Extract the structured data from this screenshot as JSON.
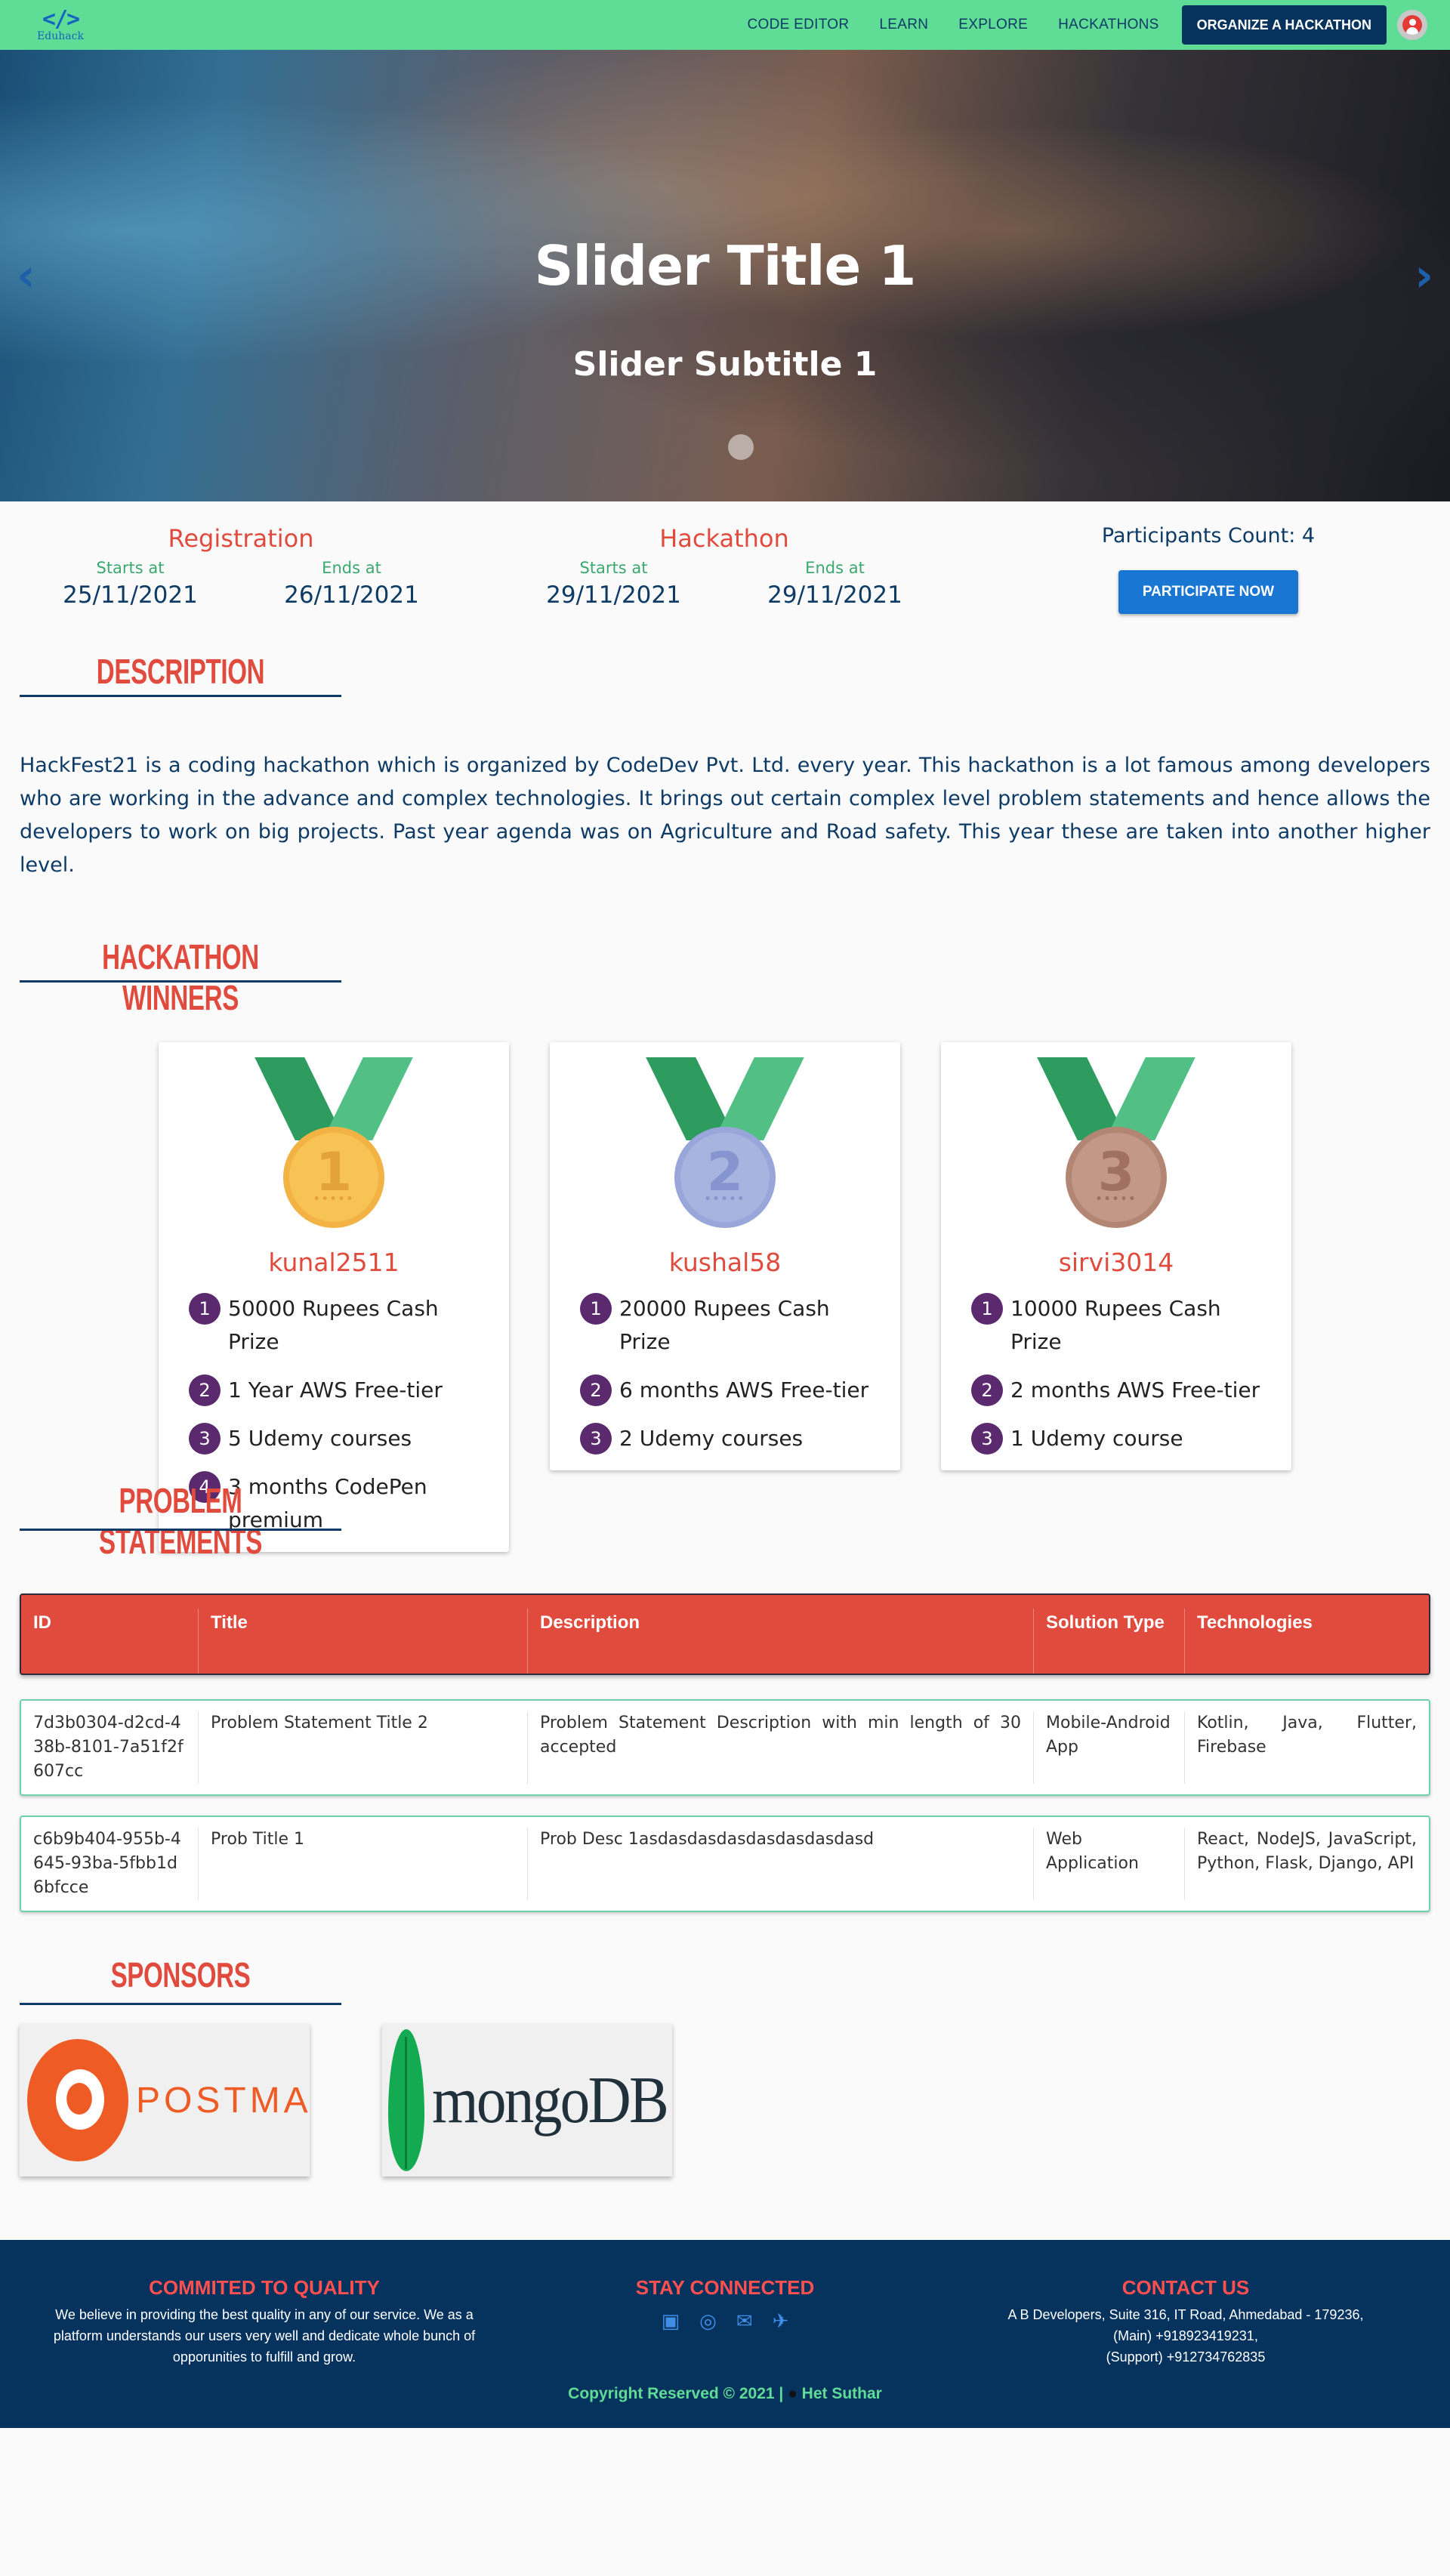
{
  "nav": {
    "logo_mark": "</>",
    "logo_name": "Eduhack",
    "links": [
      "CODE EDITOR",
      "LEARN",
      "EXPLORE",
      "HACKATHONS"
    ],
    "cta": "ORGANIZE A HACKATHON",
    "avatar_icon": "account-circle-icon"
  },
  "hero": {
    "title": "Slider Title 1",
    "subtitle": "Slider Subtitle 1",
    "prev_icon": "‹",
    "next_icon": "›"
  },
  "dates": {
    "registration": {
      "title": "Registration",
      "start_label": "Starts at",
      "start": "25/11/2021",
      "end_label": "Ends at",
      "end": "26/11/2021"
    },
    "hackathon": {
      "title": "Hackathon",
      "start_label": "Starts at",
      "start": "29/11/2021",
      "end_label": "Ends at",
      "end": "29/11/2021"
    },
    "participants": "Participants Count: 4",
    "participate_button": "PARTICIPATE NOW"
  },
  "description": {
    "heading": "DESCRIPTION",
    "text": "HackFest21 is a coding hackathon which is organized by CodeDev Pvt. Ltd. every year. This hackathon is a lot famous among developers who are working in the advance and complex technologies. It brings out certain complex level problem statements and hence allows the developers to work on big projects. Past year agenda was on Agriculture and Road safety. This year these are taken into another higher level."
  },
  "winners": {
    "heading": "HACKATHON WINNERS",
    "cards": [
      {
        "rank": "1",
        "name": "kunal2511",
        "prizes": [
          {
            "n": "1",
            "text": "50000 Rupees Cash Prize"
          },
          {
            "n": "2",
            "text": "1 Year AWS Free-tier"
          },
          {
            "n": "3",
            "text": "5 Udemy courses"
          },
          {
            "n": "4",
            "text": "3 months CodePen premium"
          }
        ]
      },
      {
        "rank": "2",
        "name": "kushal58",
        "prizes": [
          {
            "n": "1",
            "text": "20000 Rupees Cash Prize"
          },
          {
            "n": "2",
            "text": "6 months AWS Free-tier"
          },
          {
            "n": "3",
            "text": "2 Udemy courses"
          }
        ]
      },
      {
        "rank": "3",
        "name": "sirvi3014",
        "prizes": [
          {
            "n": "1",
            "text": "10000 Rupees Cash Prize"
          },
          {
            "n": "2",
            "text": "2 months AWS Free-tier"
          },
          {
            "n": "3",
            "text": "1 Udemy course"
          }
        ]
      }
    ]
  },
  "problems": {
    "heading": "PROBLEM STATEMENTS",
    "columns": [
      "ID",
      "Title",
      "Description",
      "Solution Type",
      "Technologies"
    ],
    "rows": [
      {
        "id": "7d3b0304-d2cd-438b-8101-7a51f2f607cc",
        "title": "Problem Statement Title 2",
        "description": "Problem Statement Description with min length of 30 accepted",
        "type": "Mobile-Android App",
        "tech": "Kotlin, Java, Flutter, Firebase"
      },
      {
        "id": "c6b9b404-955b-4645-93ba-5fbb1d6bfcce",
        "title": "Prob Title 1",
        "description": "Prob Desc 1asdasdasdasdasdasdasdasd",
        "type": "Web Application",
        "tech": "React, NodeJS, JavaScript, Python, Flask, Django, API"
      }
    ]
  },
  "sponsors": {
    "heading": "SPONSORS",
    "logos": [
      {
        "name": "POSTMAN",
        "icon": "postman-logo"
      },
      {
        "name": "mongoDB",
        "icon": "mongodb-logo"
      }
    ]
  },
  "footer": {
    "quality_title": "COMMITED TO QUALITY",
    "quality_text": "We believe in providing the best quality in any of our service. We as a platform understands our users very well and dedicate whole bunch of opporunities to fulfill and grow.",
    "connect_title": "STAY CONNECTED",
    "social_icons": [
      "facebook-icon",
      "instagram-icon",
      "email-icon",
      "twitter-icon"
    ],
    "contact_title": "CONTACT US",
    "contact_address": "A B Developers, Suite 316, IT Road, Ahmedabad - 179236,",
    "contact_main": "(Main) +918923419231,",
    "contact_support": "(Support) +912734762835",
    "copyright": "Copyright Reserved © 2021 |",
    "author": "Het Suthar"
  },
  "colors": {
    "nav_bg": "#5fdd96",
    "primary_dark": "#06325e",
    "accent_red": "#e04b3e",
    "button_blue": "#1976d2"
  }
}
